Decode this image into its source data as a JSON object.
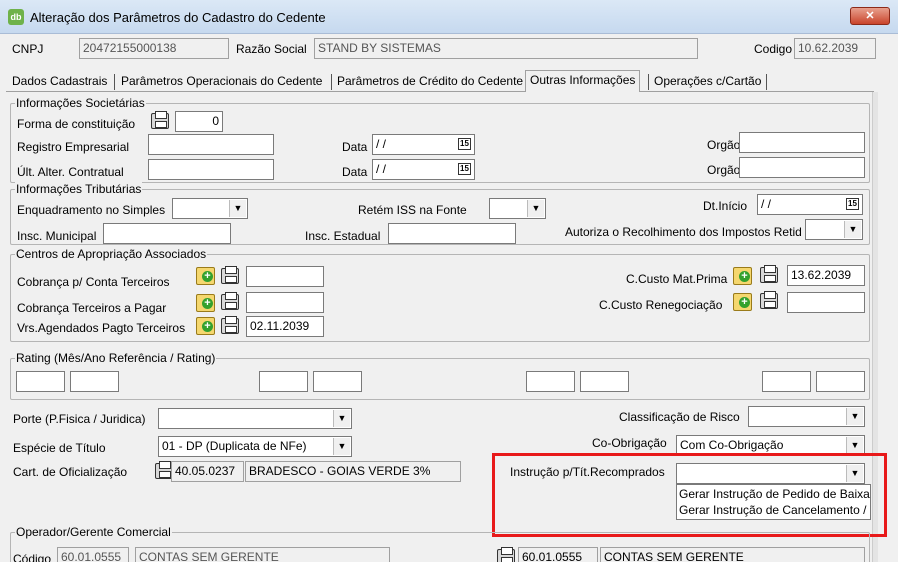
{
  "window": {
    "title": "Alteração dos Parâmetros do Cadastro do Cedente",
    "close_label": "✕"
  },
  "header": {
    "cnpj_label": "CNPJ",
    "cnpj_value": "20472155000138",
    "razao_label": "Razão Social",
    "razao_value": "STAND BY SISTEMAS",
    "codigo_label": "Codigo",
    "codigo_value": "10.62.2039"
  },
  "tabs": [
    {
      "label": "Dados Cadastrais"
    },
    {
      "label": "Parâmetros Operacionais do Cedente"
    },
    {
      "label": "Parâmetros de Crédito do Cedente"
    },
    {
      "label": "Outras Informações"
    },
    {
      "label": "Operações c/Cartão"
    }
  ],
  "societarias": {
    "title": "Informações Societárias",
    "forma_label": "Forma de constituição",
    "forma_value": "0",
    "registro_label": "Registro Empresarial",
    "data_label": "Data",
    "date_placeholder": " / /",
    "orgao_label": "Orgão",
    "ult_label": "Últ. Alter. Contratual"
  },
  "tributarias": {
    "title": "Informações Tributárias",
    "enquadramento_label": "Enquadramento no Simples",
    "retem_label": "Retém ISS na Fonte",
    "dtinicio_label": "Dt.Início",
    "dtinicio_value": " / /",
    "insc_municipal_label": "Insc. Municipal",
    "insc_estadual_label": "Insc. Estadual",
    "autoriza_label": "Autoriza o Recolhimento  dos Impostos Retid"
  },
  "centros": {
    "title": "Centros de Apropriação Associados",
    "cobranca_conta_label": "Cobrança p/ Conta Terceiros",
    "cobranca_pagar_label": "Cobrança Terceiros a Pagar",
    "vrs_label": "Vrs.Agendados Pagto Terceiros",
    "vrs_value": "02.11.2039",
    "custo_mat_label": "C.Custo Mat.Prima",
    "custo_mat_value": "13.62.2039",
    "custo_reneg_label": "C.Custo Renegociação"
  },
  "rating": {
    "title": "Rating (Mês/Ano Referência / Rating)"
  },
  "misc": {
    "porte_label": "Porte (P.Fisica / Juridica)",
    "especie_label": "Espécie de Título",
    "especie_value": "01 - DP (Duplicata de NFe)",
    "cart_label": "Cart. de Oficialização",
    "cart_code": "40.05.0237",
    "cart_name": "BRADESCO - GOIAS VERDE 3%",
    "classificacao_label": "Classificação de Risco",
    "coobrigacao_label": "Co-Obrigação",
    "coobrigacao_value": "Com Co-Obrigação",
    "instrucao_label": "Instrução p/Tít.Recomprados",
    "instrucao_options": [
      "Gerar Instrução de Pedido de Baixa",
      "Gerar Instrução de Cancelamento /"
    ],
    "highlight_color": "#e8191a"
  },
  "operador": {
    "title": "Operador/Gerente Comercial",
    "codigo_label": "Código",
    "codigo_value": "60.01.0555",
    "nome_value": "CONTAS SEM GERENTE",
    "codigo2_value": "60.01.0555",
    "nome2_value": "CONTAS SEM GERENTE"
  }
}
